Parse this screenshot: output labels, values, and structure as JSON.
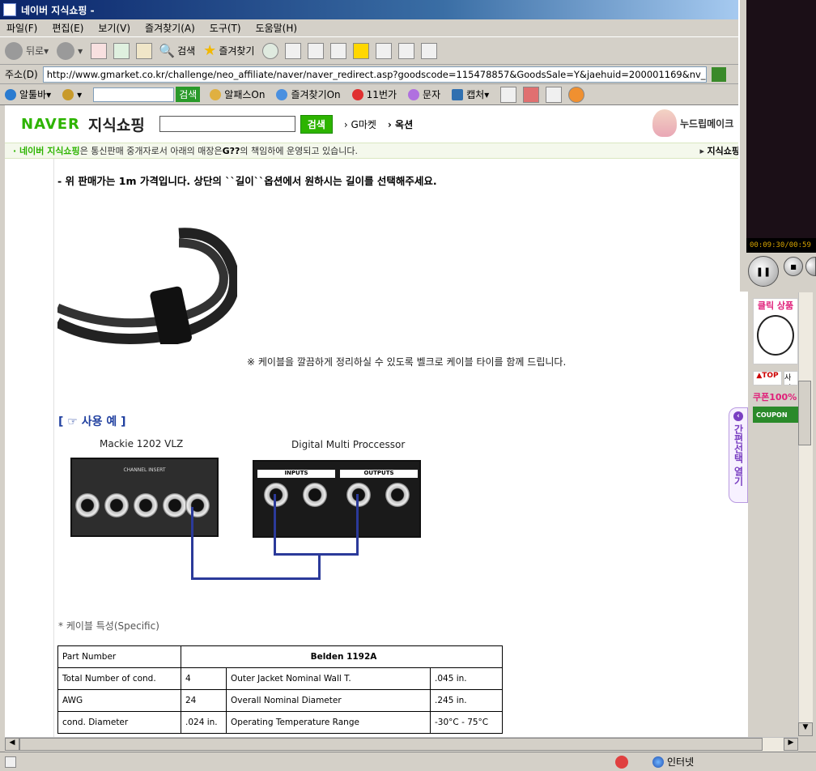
{
  "window": {
    "title": "네이버 지식쇼핑 -"
  },
  "menu": [
    "파일(F)",
    "편집(E)",
    "보기(V)",
    "즐겨찾기(A)",
    "도구(T)",
    "도움말(H)"
  ],
  "toolbar": {
    "back": "뒤로",
    "search": "검색",
    "favorites": "즐겨찾기"
  },
  "address": {
    "label": "주소(D)",
    "url": "http://www.gmarket.co.kr/challenge/neo_affiliate/naver/naver_redirect.asp?goodscode=115478857&GoodsSale=Y&jaehuid=200001169&nv_pch"
  },
  "links_bar": {
    "altoolbar": "알툴바",
    "search_btn": "검색",
    "alpass": "알패스On",
    "fav_on": "즐겨찾기On",
    "st11": "11번가",
    "sms": "문자",
    "capture": "캡처"
  },
  "naver": {
    "logo": "NAVER",
    "shop": "지식쇼핑",
    "search_btn": "검색",
    "link1": "G마켓",
    "link2": "옥션",
    "ad": "누드립메이크"
  },
  "notice": {
    "prefix": "· 네이버 지식쇼핑",
    "text": "은 통신판매 중개자로서 아래의 매장은 ",
    "store": "G??",
    "suffix": "의 책임하에 운영되고 있습니다.",
    "right": "지식쇼핑"
  },
  "content": {
    "price_note": "- 위 판매가는 1m 가격입니다. 상단의 ``길이``옵션에서 원하시는 길이를 선택해주세요.",
    "velcro_note": "※ 케이블을 깔끔하게 정리하실 수 있도록 벨크로 케이블 타이를 함께 드립니다.",
    "example_title": "[ ☞ 사용 예 ]",
    "device1": "Mackie 1202 VLZ",
    "device2": "Digital Multi Proccessor",
    "channel_insert": "CHANNEL INSERT",
    "inputs": "INPUTS",
    "outputs": "OUTPUTS",
    "spec_title": "* 케이블 특성(Specific)"
  },
  "spec_table": {
    "header": [
      "Part Number",
      "Belden 1192A"
    ],
    "rows": [
      [
        "Total Number of cond.",
        "4",
        "Outer Jacket Nominal Wall T.",
        ".045 in."
      ],
      [
        "AWG",
        "24",
        "Overall Nominal Diameter",
        ".245 in."
      ],
      [
        "cond. Diameter",
        ".024 in.",
        "Operating Temperature Range",
        "-30°C - 75°C"
      ]
    ]
  },
  "player": {
    "time": "00:09:30/00:59"
  },
  "side": {
    "ad": "클릭 상품",
    "top": "▲TOP",
    "photo": "사진",
    "coupon": "쿠폰100%",
    "coupon2": "COUPON",
    "tab": "간편선택 열기"
  },
  "status": {
    "zone": "인터넷"
  }
}
